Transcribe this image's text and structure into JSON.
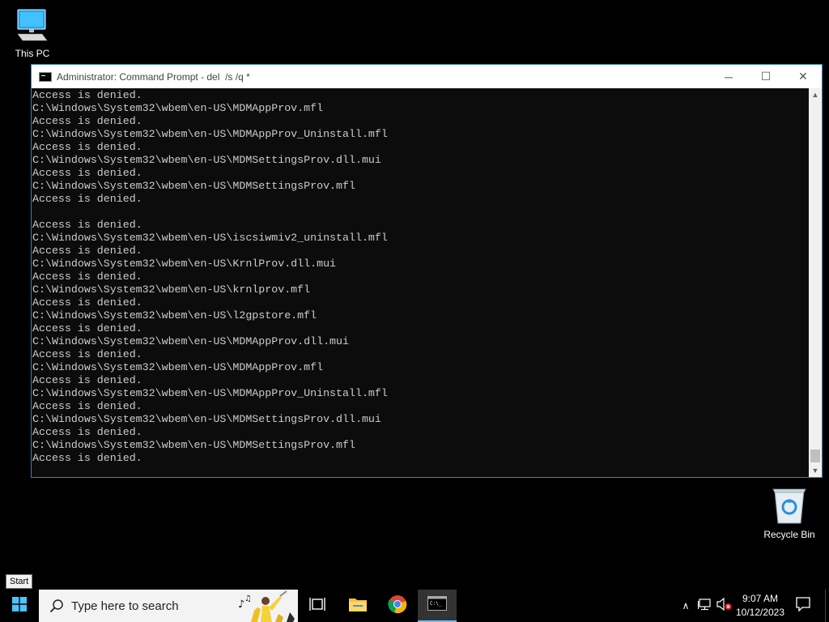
{
  "desktop": {
    "icons": [
      {
        "label": "This PC",
        "icon": "computer-icon"
      },
      {
        "label": "Recycle Bin",
        "icon": "recycle-bin-icon"
      }
    ]
  },
  "window": {
    "title": "Administrator: Command Prompt - del  /s /q *",
    "controls": {
      "minimize": "─",
      "maximize": "☐",
      "close": "✕"
    },
    "scroll": {
      "up": "▲",
      "down": "▼"
    }
  },
  "console": {
    "lines": [
      "Access is denied.",
      "C:\\Windows\\System32\\wbem\\en-US\\MDMAppProv.mfl",
      "Access is denied.",
      "C:\\Windows\\System32\\wbem\\en-US\\MDMAppProv_Uninstall.mfl",
      "Access is denied.",
      "C:\\Windows\\System32\\wbem\\en-US\\MDMSettingsProv.dll.mui",
      "Access is denied.",
      "C:\\Windows\\System32\\wbem\\en-US\\MDMSettingsProv.mfl",
      "Access is denied.",
      "",
      "Access is denied.",
      "C:\\Windows\\System32\\wbem\\en-US\\iscsiwmiv2_uninstall.mfl",
      "Access is denied.",
      "C:\\Windows\\System32\\wbem\\en-US\\KrnlProv.dll.mui",
      "Access is denied.",
      "C:\\Windows\\System32\\wbem\\en-US\\krnlprov.mfl",
      "Access is denied.",
      "C:\\Windows\\System32\\wbem\\en-US\\l2gpstore.mfl",
      "Access is denied.",
      "C:\\Windows\\System32\\wbem\\en-US\\MDMAppProv.dll.mui",
      "Access is denied.",
      "C:\\Windows\\System32\\wbem\\en-US\\MDMAppProv.mfl",
      "Access is denied.",
      "C:\\Windows\\System32\\wbem\\en-US\\MDMAppProv_Uninstall.mfl",
      "Access is denied.",
      "C:\\Windows\\System32\\wbem\\en-US\\MDMSettingsProv.dll.mui",
      "Access is denied.",
      "C:\\Windows\\System32\\wbem\\en-US\\MDMSettingsProv.mfl",
      "Access is denied."
    ]
  },
  "tooltip": {
    "text": "Start"
  },
  "taskbar": {
    "search_placeholder": "Type here to search",
    "apps": [
      {
        "name": "Task View",
        "icon": "task-view-icon"
      },
      {
        "name": "File Explorer",
        "icon": "folder-icon"
      },
      {
        "name": "Google Chrome",
        "icon": "chrome-icon"
      },
      {
        "name": "Command Prompt",
        "icon": "cmd-icon",
        "active": true
      }
    ],
    "tray": {
      "chevron": "∧",
      "time": "9:07 AM",
      "date": "10/12/2023"
    }
  },
  "colors": {
    "console_bg": "#0c0c0c",
    "console_text": "#cccccc",
    "window_border": "#3c7fb1",
    "taskbar_bg": "#000000",
    "active_indicator": "#76b9ed"
  }
}
